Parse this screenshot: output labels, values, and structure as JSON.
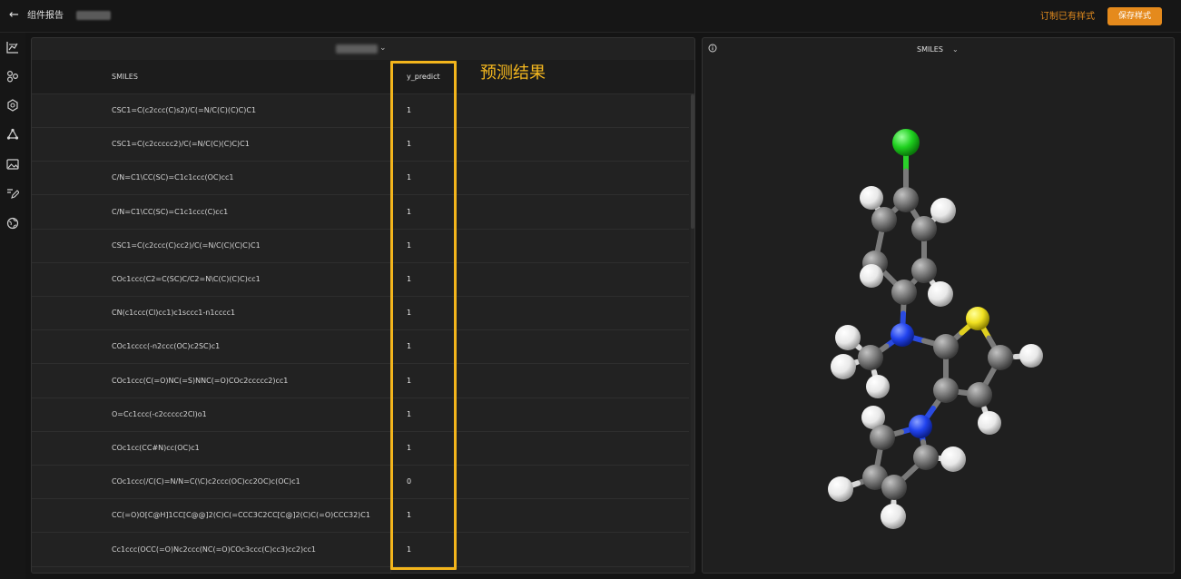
{
  "topbar": {
    "back_icon": "arrow-left-icon",
    "breadcrumb": "组件报告",
    "design_link": "订制已有样式",
    "save_label": "保存样式"
  },
  "sidebar": {
    "icons": [
      "line-chart-icon",
      "share-nodes-icon",
      "molecule-icon",
      "triangle-nodes-icon",
      "image-icon",
      "pen-icon",
      "globe-icon"
    ]
  },
  "table": {
    "columns": [
      "SMILES",
      "y_predict"
    ],
    "rows": [
      {
        "smiles": "CSC1=C(c2ccc(C)s2)/C(=N/C(C)(C)C)C1",
        "pred": "1"
      },
      {
        "smiles": "CSC1=C(c2ccccc2)/C(=N/C(C)(C)C)C1",
        "pred": "1"
      },
      {
        "smiles": "C/N=C1\\CC(SC)=C1c1ccc(OC)cc1",
        "pred": "1"
      },
      {
        "smiles": "C/N=C1\\CC(SC)=C1c1ccc(C)cc1",
        "pred": "1"
      },
      {
        "smiles": "CSC1=C(c2ccc(C)cc2)/C(=N/C(C)(C)C)C1",
        "pred": "1"
      },
      {
        "smiles": "COc1ccc(C2=C(SC)C/C2=N\\C(C)(C)C)cc1",
        "pred": "1"
      },
      {
        "smiles": "CN(c1ccc(Cl)cc1)c1sccc1-n1cccc1",
        "pred": "1"
      },
      {
        "smiles": "COc1cccc(-n2ccc(OC)c2SC)c1",
        "pred": "1"
      },
      {
        "smiles": "COc1ccc(C(=O)NC(=S)NNC(=O)COc2ccccc2)cc1",
        "pred": "1"
      },
      {
        "smiles": "O=Cc1ccc(-c2ccccc2Cl)o1",
        "pred": "1"
      },
      {
        "smiles": "COc1cc(CC#N)cc(OC)c1",
        "pred": "1"
      },
      {
        "smiles": "COc1ccc(/C(C)=N/N=C(\\C)c2ccc(OC)cc2OC)c(OC)c1",
        "pred": "0"
      },
      {
        "smiles": "CC(=O)O[C@H]1CC[C@@]2(C)C(=CCC3C2CC[C@]2(C)C(=O)CCC32)C1",
        "pred": "1"
      },
      {
        "smiles": "Cc1ccc(OCC(=O)Nc2ccc(NC(=O)COc3ccc(C)cc3)cc2)cc1",
        "pred": "1"
      }
    ]
  },
  "annotation": {
    "label": "预测结果",
    "color": "#f3b51c"
  },
  "viewer": {
    "info_icon": "info-circle-icon",
    "title": "SMILES",
    "chevron_icon": "chevron-down-icon"
  },
  "colors": {
    "accent": "#e58a1c",
    "carbon": "#7a7a7a",
    "hydrogen": "#f2f2f2",
    "nitrogen": "#2143ee",
    "sulfur": "#f0e020",
    "chlorine": "#1fd11f"
  }
}
